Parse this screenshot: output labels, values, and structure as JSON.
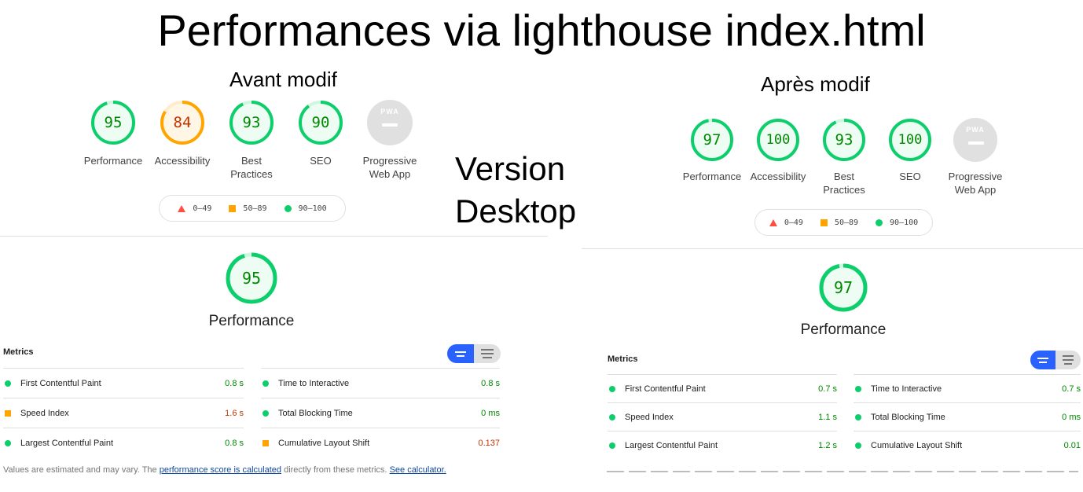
{
  "title": "Performances via lighthouse index.html",
  "version_label": [
    "Version",
    "Desktop"
  ],
  "before": {
    "caption": "Avant modif",
    "gauges": [
      {
        "score": "95",
        "label": [
          "Performance"
        ],
        "level": "pass"
      },
      {
        "score": "84",
        "label": [
          "Accessibility"
        ],
        "level": "average"
      },
      {
        "score": "93",
        "label": [
          "Best",
          "Practices"
        ],
        "level": "pass"
      },
      {
        "score": "90",
        "label": [
          "SEO"
        ],
        "level": "pass"
      }
    ],
    "pwa": {
      "badge": "PWA",
      "label": [
        "Progressive",
        "Web App"
      ]
    },
    "legend": [
      "0–49",
      "50–89",
      "90–100"
    ],
    "perf_score": "95",
    "perf_title": "Performance",
    "metrics_heading": "Metrics",
    "metrics": [
      {
        "name": "First Contentful Paint",
        "value": "0.8 s",
        "status": "pass"
      },
      {
        "name": "Time to Interactive",
        "value": "0.8 s",
        "status": "pass"
      },
      {
        "name": "Speed Index",
        "value": "1.6 s",
        "status": "average"
      },
      {
        "name": "Total Blocking Time",
        "value": "0 ms",
        "status": "pass"
      },
      {
        "name": "Largest Contentful Paint",
        "value": "0.8 s",
        "status": "pass"
      },
      {
        "name": "Cumulative Layout Shift",
        "value": "0.137",
        "status": "average"
      }
    ],
    "note": {
      "prefix": "Values are estimated and may vary. The ",
      "link1": "performance score is calculated",
      "middle": " directly from these metrics. ",
      "link2": "See calculator."
    }
  },
  "after": {
    "caption": "Après modif",
    "gauges": [
      {
        "score": "97",
        "label": [
          "Performance"
        ],
        "level": "pass"
      },
      {
        "score": "100",
        "label": [
          "Accessibility"
        ],
        "level": "pass"
      },
      {
        "score": "93",
        "label": [
          "Best",
          "Practices"
        ],
        "level": "pass"
      },
      {
        "score": "100",
        "label": [
          "SEO"
        ],
        "level": "pass"
      }
    ],
    "pwa": {
      "badge": "PWA",
      "label": [
        "Progressive",
        "Web App"
      ]
    },
    "legend": [
      "0–49",
      "50–89",
      "90–100"
    ],
    "perf_score": "97",
    "perf_title": "Performance",
    "metrics_heading": "Metrics",
    "metrics": [
      {
        "name": "First Contentful Paint",
        "value": "0.7 s",
        "status": "pass"
      },
      {
        "name": "Time to Interactive",
        "value": "0.7 s",
        "status": "pass"
      },
      {
        "name": "Speed Index",
        "value": "1.1 s",
        "status": "pass"
      },
      {
        "name": "Total Blocking Time",
        "value": "0 ms",
        "status": "pass"
      },
      {
        "name": "Largest Contentful Paint",
        "value": "1.2 s",
        "status": "pass"
      },
      {
        "name": "Cumulative Layout Shift",
        "value": "0.01",
        "status": "pass"
      }
    ]
  },
  "colors": {
    "pass": "#0cce6b",
    "pass_text": "#008800",
    "average": "#ffa400",
    "average_text": "#c33300",
    "fail": "#ff4e42",
    "link": "#0d47a1",
    "toggle_active": "#2962ff"
  }
}
